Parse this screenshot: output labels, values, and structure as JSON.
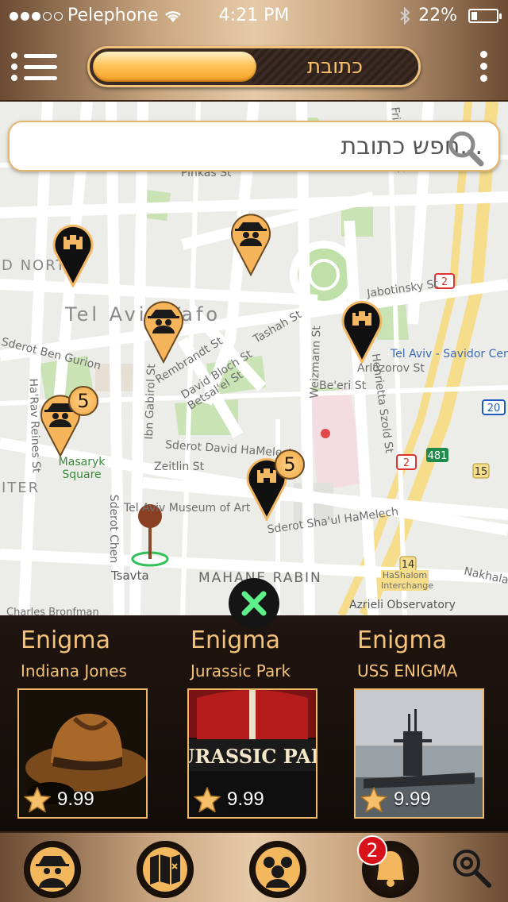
{
  "status_bar": {
    "carrier": "Pelephone",
    "time": "4:21 PM",
    "battery_percent": "22%",
    "battery_level": 0.22,
    "signal_bars": 3
  },
  "header": {
    "toggle_label": "כתובת",
    "toggle_selected": "left"
  },
  "search": {
    "placeholder": "...חפש כתובת"
  },
  "map": {
    "street_labels": [
      "Pinkas St",
      "Tel Aviv-Yafo",
      "D NORT",
      "Jabotinsky St",
      "Tel Aviv - Savidor Center",
      "Arlozorov St",
      "Be'eri St",
      "Sderot Ben Gurion",
      "Rembrandt St",
      "David Bloch St",
      "Betsal'el St",
      "Tashah St",
      "Weizmann St",
      "Ibn Gabirol St",
      "Henrietta Szold St",
      "Sderot David HaMelech",
      "Zeitlin St",
      "Masaryk Square",
      "Tel Aviv Museum of Art",
      "Sderot Sha'ul HaMelech",
      "Sderot Chen",
      "Tsavta",
      "MAHANE RABIN",
      "Charles Bronfman",
      "Azrieli Observatory",
      "HaShalom Interchange",
      "Nakhalat",
      "Frishman St",
      "Ha'Rav Reines St",
      "ITER"
    ],
    "road_shields": [
      "2",
      "2",
      "20",
      "481",
      "15",
      "14"
    ],
    "pins": [
      {
        "type": "castle",
        "badge": ""
      },
      {
        "type": "spy",
        "badge": ""
      },
      {
        "type": "spy",
        "badge": ""
      },
      {
        "type": "castle",
        "badge": ""
      },
      {
        "type": "spy",
        "badge": "5"
      },
      {
        "type": "castle",
        "badge": "5"
      }
    ]
  },
  "cards": [
    {
      "title": "Enigma",
      "subtitle": "Indiana Jones",
      "price": "9.99",
      "image": "fedora-hat"
    },
    {
      "title": "Enigma",
      "subtitle": "Jurassic Park",
      "price": "9.99",
      "image": "jurassic-park-logo",
      "logo_text": "URASSIC PAR"
    },
    {
      "title": "Enigma",
      "subtitle": "USS ENIGMA",
      "price": "9.99",
      "image": "submarine"
    }
  ],
  "tabbar": {
    "items": [
      "spy-icon",
      "map-icon",
      "group-icon",
      "bell-icon",
      "settings-search-icon"
    ],
    "notification_count": "2"
  },
  "colors": {
    "accent": "#f4c27a",
    "panel_bg": "#1a120c",
    "bronze": "#c8a57f"
  }
}
